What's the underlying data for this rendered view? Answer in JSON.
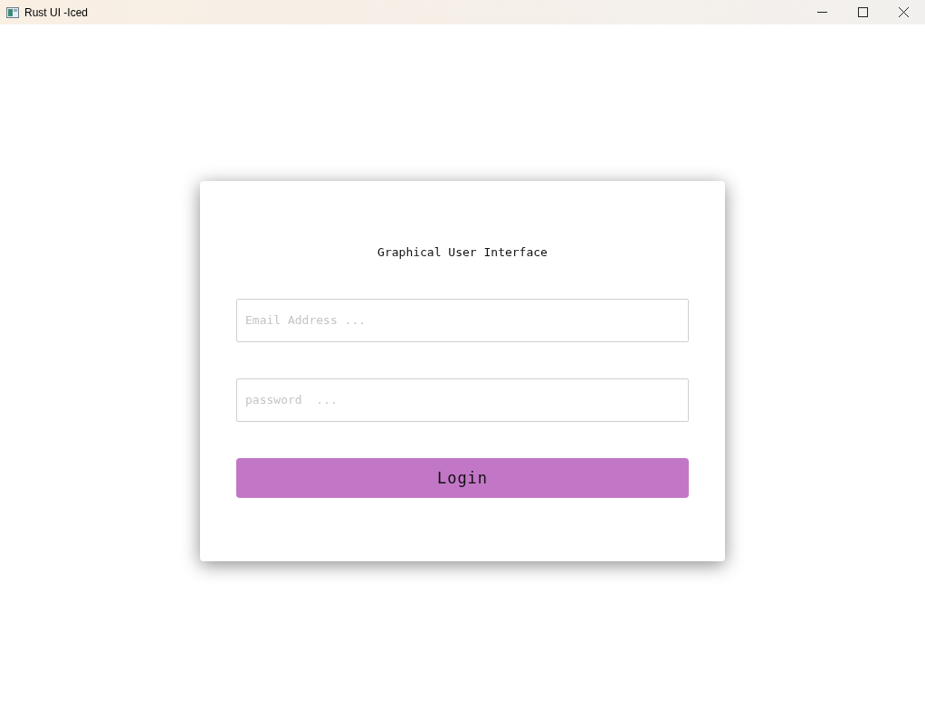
{
  "window": {
    "title": "Rust UI -Iced"
  },
  "form": {
    "heading": "Graphical User Interface",
    "fields": [
      {
        "placeholder": "Email Address ..."
      },
      {
        "placeholder": "password  ..."
      }
    ],
    "button": "Login"
  }
}
